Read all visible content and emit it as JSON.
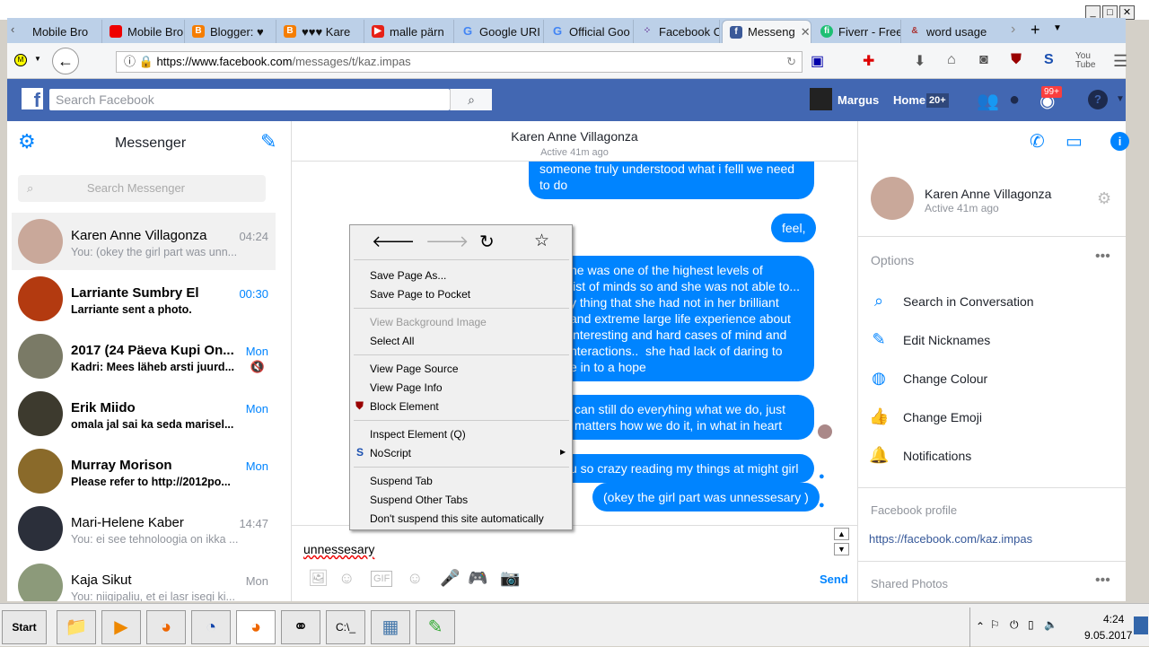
{
  "browser": {
    "tabs": [
      {
        "label": "Mobile Bro",
        "icon": "generic"
      },
      {
        "label": "Mobile Bro",
        "icon": "huawei"
      },
      {
        "label": "Blogger: ♥",
        "icon": "blogger"
      },
      {
        "label": "♥♥♥ Kare",
        "icon": "blogger"
      },
      {
        "label": "malle pärn",
        "icon": "youtube"
      },
      {
        "label": "Google URI",
        "icon": "google"
      },
      {
        "label": "Official Goo",
        "icon": "google"
      },
      {
        "label": "Facebook C",
        "icon": "grid"
      },
      {
        "label": "Messeng",
        "icon": "facebook"
      },
      {
        "label": "Fiverr - Free",
        "icon": "fiverr"
      },
      {
        "label": "word usage",
        "icon": "ampersand"
      }
    ],
    "url_host": "https://www.facebook.com",
    "url_path": "/messages/t/kaz.impas"
  },
  "fb": {
    "search_placeholder": "Search Facebook",
    "user": "Margus",
    "home": "Home",
    "home_badge": "20+",
    "notif_badge": "99+"
  },
  "left": {
    "title": "Messenger",
    "search_placeholder": "Search Messenger",
    "conversations": [
      {
        "name": "Karen Anne Villagonza",
        "preview": "You: (okey the girl part was unn...",
        "time": "04:24"
      },
      {
        "name": "Larriante Sumbry El",
        "preview": "Larriante sent a photo.",
        "time": "00:30"
      },
      {
        "name": "2017 (24 Päeva Kupi On...",
        "preview": "Kadri: Mees läheb arsti juurd...",
        "time": "Mon"
      },
      {
        "name": "Erik Miido",
        "preview": "omala jal sai ka seda marisel...",
        "time": "Mon"
      },
      {
        "name": "Murray Morison",
        "preview": "Please refer to http://2012po...",
        "time": "Mon"
      },
      {
        "name": "Mari-Helene Kaber",
        "preview": "You: ei see tehnoloogia on ikka ...",
        "time": "14:47"
      },
      {
        "name": "Kaja Sikut",
        "preview": "You: niigipaliu, et ei lasr isegi ki...",
        "time": "Mon"
      }
    ]
  },
  "chat": {
    "name": "Karen Anne Villagonza",
    "status": "Active 41m ago",
    "messages": [
      "someone truly understood what i felll we need to do",
      "feel,",
      "he was one of the highest levels of\nlist of minds so and she was not able to...\ny thing that she had not in her brilliant\nand extreme large life experience about\ninteresting and hard cases of mind and\nnteractions..  she had lack of daring to\ne in to a hope",
      "can still do everyhing what we do, just\nmatters how we do it, in what in heart",
      "u so crazy reading my things at might girl",
      "(okey the girl part was unnessesary )"
    ],
    "input": "unnessesary",
    "send": "Send"
  },
  "right": {
    "name": "Karen Anne Villagonza",
    "status": "Active 41m ago",
    "options_title": "Options",
    "options": [
      "Search in Conversation",
      "Edit Nicknames",
      "Change Colour",
      "Change Emoji",
      "Notifications"
    ],
    "profile_title": "Facebook profile",
    "profile_link": "https://facebook.com/kaz.impas",
    "shared_photos": "Shared Photos"
  },
  "context_menu": [
    "Save Page As...",
    "Save Page to Pocket",
    "View Background Image",
    "Select All",
    "View Page Source",
    "View Page Info",
    "Block Element",
    "Inspect Element (Q)",
    "NoScript",
    "Suspend Tab",
    "Suspend Other Tabs",
    "Don't suspend this site automatically"
  ],
  "taskbar": {
    "start": "Start",
    "time": "4:24",
    "date": "9.05.2017"
  }
}
